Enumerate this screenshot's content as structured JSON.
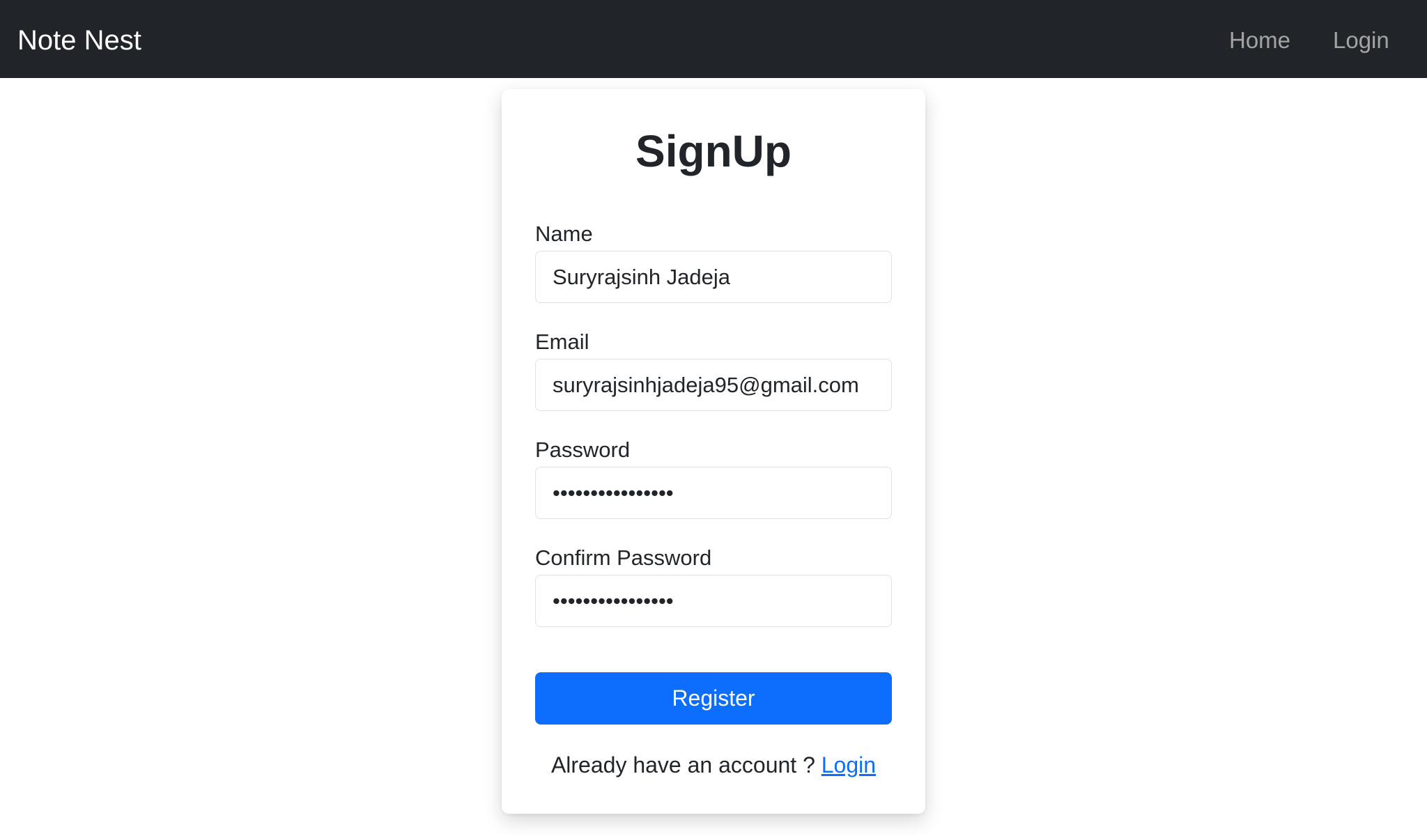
{
  "navbar": {
    "brand": "Note Nest",
    "links": [
      {
        "label": "Home"
      },
      {
        "label": "Login"
      }
    ],
    "background_color": "#212529"
  },
  "signup_form": {
    "title": "SignUp",
    "fields": {
      "name": {
        "label": "Name",
        "value": "Suryrajsinh Jadeja"
      },
      "email": {
        "label": "Email",
        "value": "suryrajsinhjadeja95@gmail.com"
      },
      "password": {
        "label": "Password",
        "value": "••••••••••••••••"
      },
      "confirm_password": {
        "label": "Confirm Password",
        "value": "••••••••••••••••"
      }
    },
    "submit_label": "Register",
    "submit_color": "#0d6efd",
    "footer_text": "Already have an account ?",
    "footer_link": "Login",
    "link_color": "#0d6efd"
  }
}
